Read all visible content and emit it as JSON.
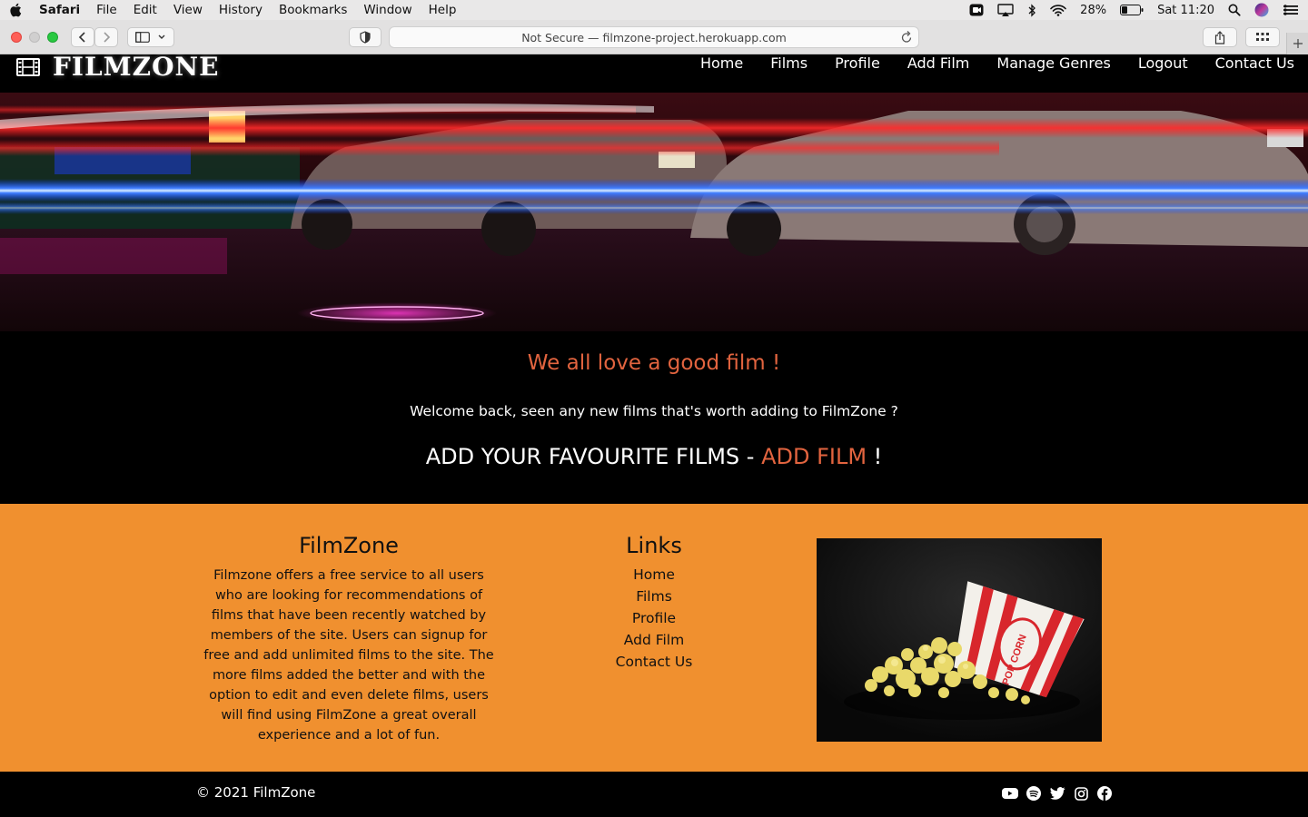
{
  "menubar": {
    "app_name": "Safari",
    "items": [
      "File",
      "Edit",
      "View",
      "History",
      "Bookmarks",
      "Window",
      "Help"
    ],
    "battery": "28%",
    "clock": "Sat 11:20"
  },
  "browser": {
    "address": "Not Secure — filmzone-project.herokuapp.com"
  },
  "site": {
    "logo": "FILMZONE",
    "nav": [
      "Home",
      "Films",
      "Profile",
      "Add Film",
      "Manage Genres",
      "Logout",
      "Contact Us"
    ]
  },
  "intro": {
    "tagline": "We all love a good film !",
    "welcome": "Welcome back, seen any new films that's worth adding to FilmZone ?",
    "cta_text": "ADD YOUR FAVOURITE FILMS - ",
    "cta_link": "ADD FILM",
    "cta_end": " !"
  },
  "footer": {
    "about_title": "FilmZone",
    "about_text": "Filmzone offers a free service to all users who are looking for recommendations of films that have been recently watched by members of the site. Users can signup for free and add unlimited films to the site. The more films added the better and with the option to edit and even delete films, users will find using FilmZone a great overall experience and a lot of fun.",
    "links_title": "Links",
    "links": [
      "Home",
      "Films",
      "Profile",
      "Add Film",
      "Contact Us"
    ],
    "popcorn_label": "POP CORN",
    "copyright": "© 2021 FilmZone",
    "socials": [
      "youtube-icon",
      "spotify-icon",
      "twitter-icon",
      "instagram-icon",
      "facebook-icon"
    ]
  },
  "colors": {
    "accent": "#e2643f",
    "footer_bg": "#f0902f"
  }
}
